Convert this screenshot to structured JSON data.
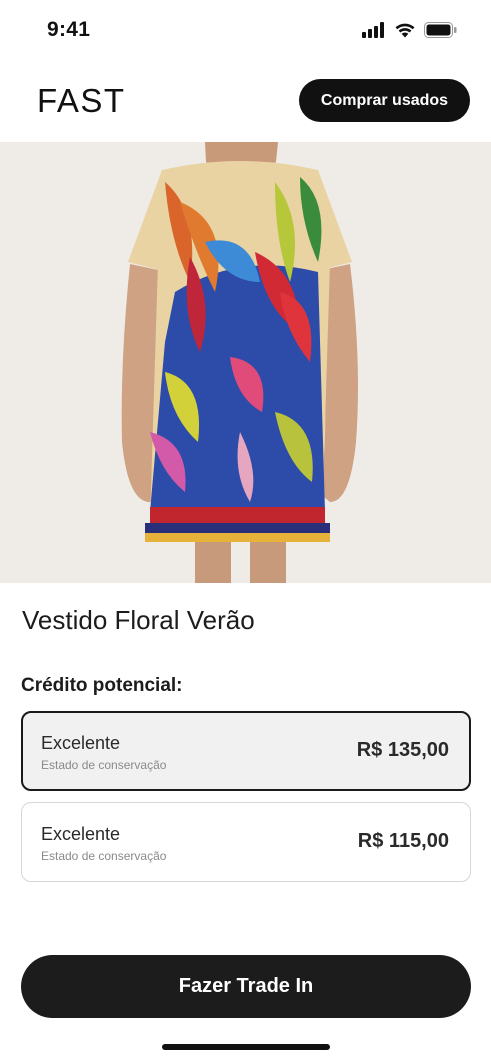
{
  "status_bar": {
    "time": "9:41"
  },
  "header": {
    "brand": "FAST",
    "buy_used_label": "Comprar usados"
  },
  "product": {
    "title": "Vestido Floral Verão"
  },
  "credit": {
    "label": "Crédito potencial:",
    "options": [
      {
        "condition": "Excelente",
        "subtitle": "Estado de conservação",
        "price": "R$ 135,00",
        "selected": true
      },
      {
        "condition": "Excelente",
        "subtitle": "Estado de conservação",
        "price": "R$ 115,00",
        "selected": false
      }
    ]
  },
  "cta": {
    "label": "Fazer Trade In"
  },
  "colors": {
    "primary": "#1c1c1c",
    "selected_bg": "#f1f1f1",
    "image_bg": "#efece8"
  },
  "icons": [
    "signal-icon",
    "wifi-icon",
    "battery-icon"
  ]
}
